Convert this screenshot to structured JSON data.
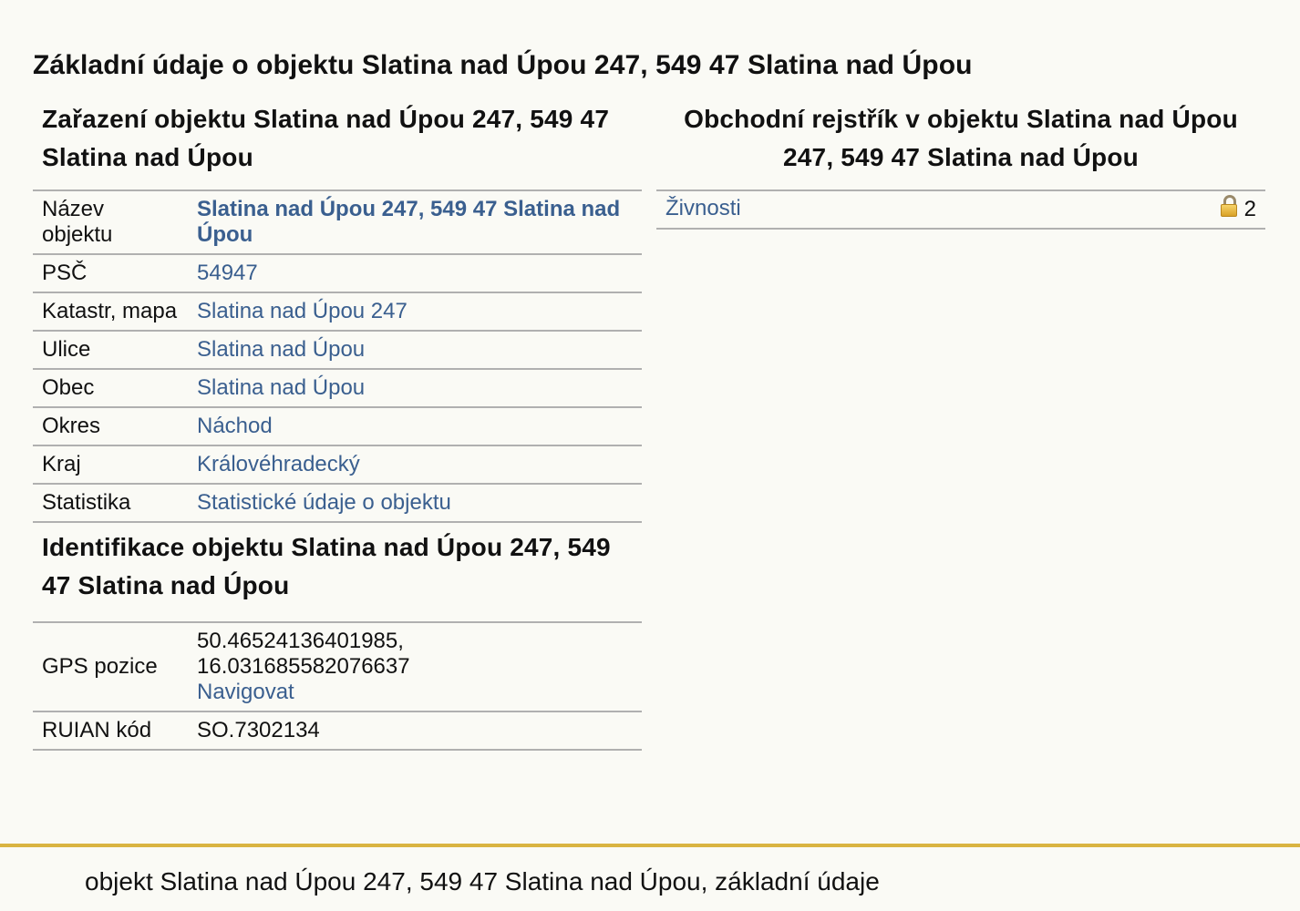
{
  "page_title": "Základní údaje o objektu Slatina nad Úpou 247, 549 47 Slatina nad Úpou",
  "classification": {
    "title": "Zařazení objektu Slatina nad Úpou 247, 549 47 Slatina nad Úpou",
    "rows": [
      {
        "label": "Název objektu",
        "value": "Slatina nad Úpou 247, 549 47 Slatina nad Úpou"
      },
      {
        "label": "PSČ",
        "value": "54947"
      },
      {
        "label": "Katastr, mapa",
        "value": "Slatina nad Úpou 247"
      },
      {
        "label": "Ulice",
        "value": "Slatina nad Úpou"
      },
      {
        "label": "Obec",
        "value": "Slatina nad Úpou"
      },
      {
        "label": "Okres",
        "value": "Náchod"
      },
      {
        "label": "Kraj",
        "value": "Královéhradecký"
      },
      {
        "label": "Statistika",
        "value": "Statistické údaje o objektu"
      }
    ]
  },
  "identification": {
    "title": "Identifikace objektu Slatina nad Úpou 247, 549 47 Slatina nad Úpou",
    "gps": {
      "label": "GPS pozice",
      "lat": "50.46524136401985,",
      "lon": "16.031685582076637",
      "navigate_label": "Navigovat"
    },
    "ruian": {
      "label": "RUIAN kód",
      "value": "SO.7302134"
    }
  },
  "business_register": {
    "title": "Obchodní rejstřík v objektu Slatina nad Úpou 247, 549 47 Slatina nad Úpou",
    "rows": [
      {
        "label": "Živnosti",
        "count": "2",
        "icon": "lock-icon"
      }
    ]
  },
  "footer": {
    "text": "objekt Slatina nad Úpou 247, 549 47 Slatina nad Úpou, základní údaje",
    "accent_color": "#d9b441"
  },
  "colors": {
    "link": "#3a5f8f",
    "background": "#fafaf5",
    "divider": "#b0b0b0"
  }
}
